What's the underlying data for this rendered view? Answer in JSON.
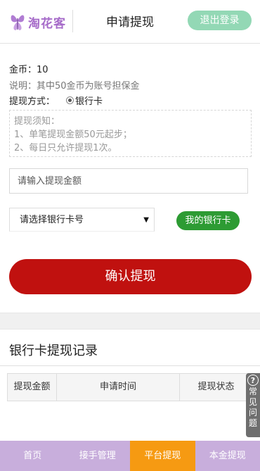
{
  "header": {
    "logo_text": "淘花客",
    "title": "申请提现",
    "logout_label": "退出登录"
  },
  "info": {
    "coins": "金币：10",
    "note": "说明：其中50金币为账号担保金",
    "method_label": "提现方式：",
    "method_value": "银行卡"
  },
  "notice": {
    "title": "提现须知：",
    "line1": "1、单笔提现金额50元起步；",
    "line2": "2、每日只允许提现1次。"
  },
  "form": {
    "amount_placeholder": "请输入提现金额",
    "bank_select": "请选择银行卡号",
    "select_arrow": "▼",
    "my_card_label": "我的银行卡",
    "confirm_label": "确认提现"
  },
  "records": {
    "title": "银行卡提现记录",
    "columns": [
      "提现金额",
      "申请时间",
      "提现状态"
    ]
  },
  "faq": {
    "icon": "?",
    "chars": [
      "常",
      "见",
      "问",
      "题"
    ]
  },
  "tabbar": {
    "items": [
      "首页",
      "接手管理",
      "平台提现",
      "本金提现"
    ],
    "active_index": 2
  },
  "colors": {
    "logo": "#a66bc9",
    "logout": "#93d8b5",
    "my_card": "#2d9b33",
    "confirm": "#c0110f",
    "tabbar": "#c8aedc",
    "tab_active": "#f69a12"
  }
}
